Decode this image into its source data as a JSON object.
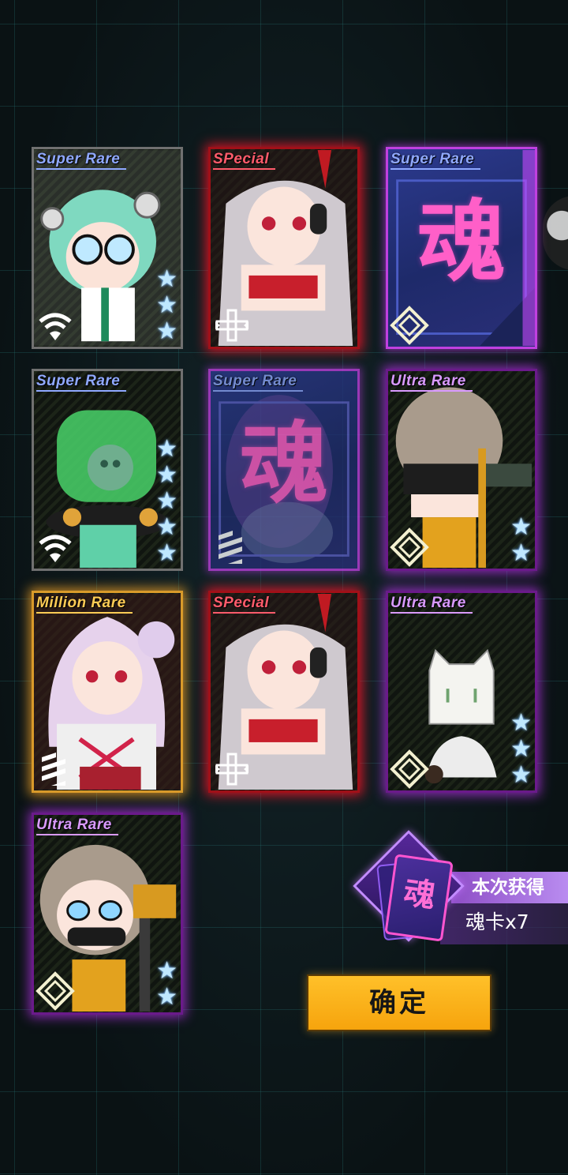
{
  "cards": [
    {
      "id": "c1",
      "rarity": "Super Rare",
      "type": "character",
      "stars": 3,
      "badge": "wifi-icon"
    },
    {
      "id": "c2",
      "rarity": "SPecial",
      "type": "character",
      "stars": 0,
      "badge": "dpad-icon"
    },
    {
      "id": "c3",
      "rarity": "Super Rare",
      "type": "soul",
      "soul_char": "魂",
      "stars": 0,
      "badge": "diamond-icon"
    },
    {
      "id": "c4",
      "rarity": "Super Rare",
      "type": "character",
      "stars": 5,
      "badge": "wifi-icon"
    },
    {
      "id": "c5",
      "rarity": "Super Rare",
      "type": "soul",
      "soul_char": "魂",
      "stars": 0,
      "badge": "bars-icon"
    },
    {
      "id": "c6",
      "rarity": "Ultra Rare",
      "type": "character",
      "stars": 2,
      "badge": "diamond-icon"
    },
    {
      "id": "c7",
      "rarity": "Million Rare",
      "type": "character",
      "stars": 0,
      "badge": "bars-icon"
    },
    {
      "id": "c8",
      "rarity": "SPecial",
      "type": "character",
      "stars": 0,
      "badge": "dpad-icon"
    },
    {
      "id": "c9",
      "rarity": "Ultra Rare",
      "type": "character",
      "stars": 3,
      "badge": "diamond-icon"
    },
    {
      "id": "c10",
      "rarity": "Ultra Rare",
      "type": "character",
      "stars": 2,
      "badge": "diamond-icon"
    }
  ],
  "summary": {
    "icon_char": "魂",
    "title": "本次获得",
    "count": "魂卡x7"
  },
  "confirm_label": "确定",
  "colors": {
    "special": "#ff1a30",
    "ultra": "#b44ae6",
    "million": "#ffaa28",
    "super": "#8fa8ff",
    "button": "#f8b21a"
  }
}
